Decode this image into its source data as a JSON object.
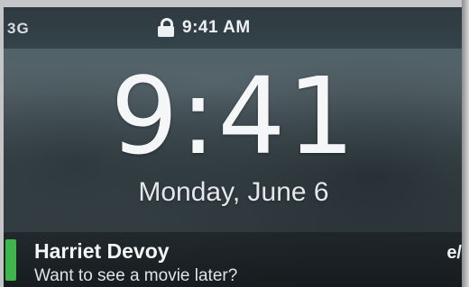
{
  "status_bar": {
    "carrier": "3G",
    "time": "9:41 AM",
    "lock_icon": "lock-icon"
  },
  "lock_screen": {
    "time": "9:41",
    "date": "Monday, June 6"
  },
  "notification": {
    "sender": "Harriet Devoy",
    "message": "Want to see a movie later?",
    "partial_text": "e/",
    "accent_color": "#3fb54c"
  }
}
